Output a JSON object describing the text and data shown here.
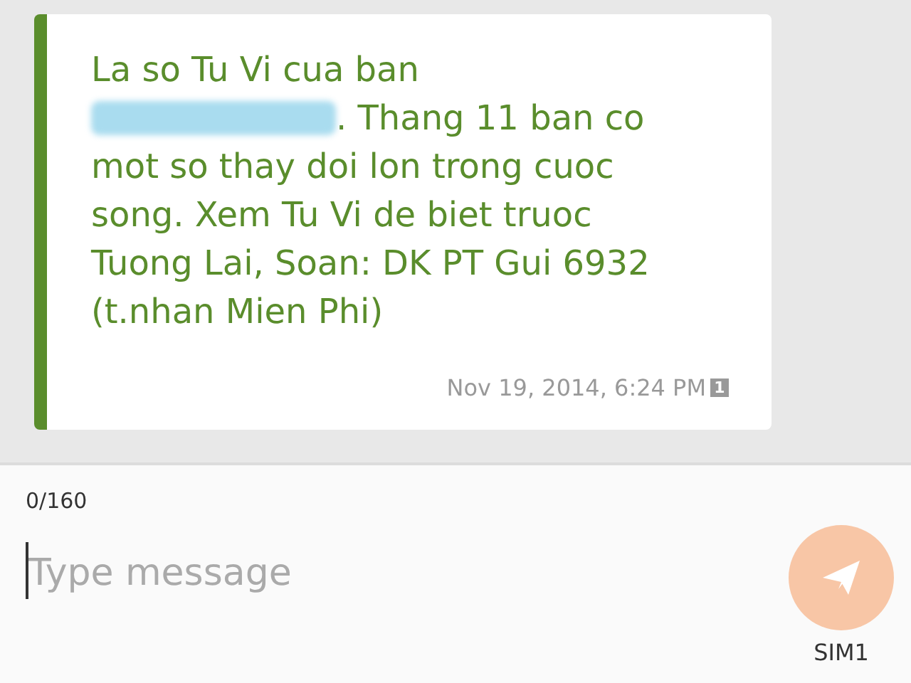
{
  "message": {
    "text_before": "La so Tu Vi cua ban",
    "redacted": true,
    "text_after": ". Thang 11 ban co mot so thay doi lon trong cuoc song. Xem Tu Vi de biet truoc Tuong Lai, Soan: DK PT Gui 6932 (t.nhan Mien Phi)",
    "timestamp": "Nov 19, 2014, 6:24 PM",
    "sim_badge": "1"
  },
  "composer": {
    "counter": "0/160",
    "placeholder": "Type message",
    "send_label": "SIM1"
  }
}
